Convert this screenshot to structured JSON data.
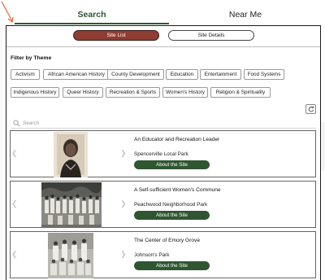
{
  "tabs": [
    {
      "label": "Search",
      "active": true
    },
    {
      "label": "Near Me",
      "active": false
    }
  ],
  "view_toggle": {
    "list_label": "Site List",
    "details_label": "Site Details",
    "active": "list"
  },
  "filter": {
    "heading": "Filter by Theme",
    "chips": [
      "Activism",
      "African American History",
      "County Development",
      "Education",
      "Entertainment",
      "Food Systems",
      "Indigenous History",
      "Queer History",
      "Recreation & Sports",
      "Women's History",
      "Religion & Spirituality"
    ]
  },
  "reset": {
    "icon": "refresh-icon"
  },
  "search": {
    "placeholder": "Search",
    "icon": "search-icon"
  },
  "sites": [
    {
      "title": "An Educator and Recreation Leader",
      "park": "Spencerville Local Park",
      "button": "About the Site"
    },
    {
      "title": "A Self-sufficient Women's Commune",
      "park": "Peachwood Neighborhood Park",
      "button": "About the Site"
    },
    {
      "title": "The Center of Emory Grove",
      "park": "Johnson's Park",
      "button": "About the Site"
    }
  ],
  "colors": {
    "accent_green": "#2f5631",
    "site_list_active": "#8f3d33",
    "annotation_arrow": "#e0693a"
  }
}
